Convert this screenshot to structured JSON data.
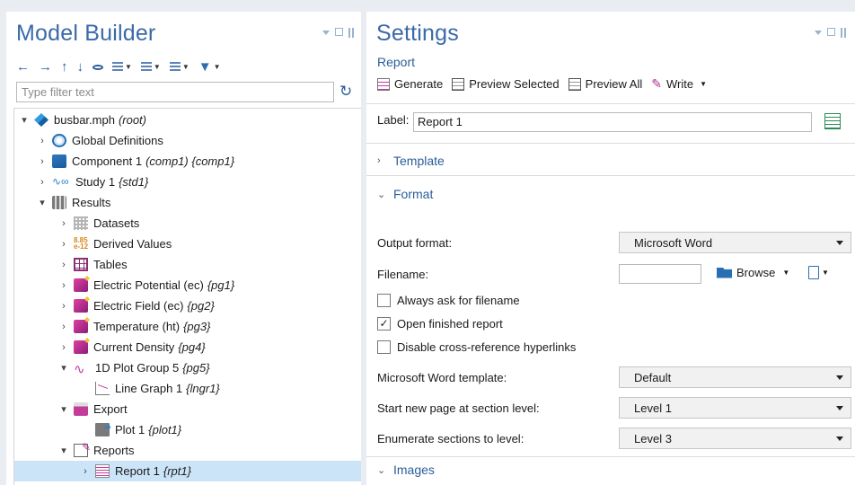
{
  "model_builder": {
    "title": "Model Builder",
    "filter_placeholder": "Type filter text",
    "tree": [
      {
        "label": "busbar.mph",
        "tag": "(root)",
        "icon": "root-icon"
      },
      {
        "label": "Global Definitions",
        "tag": "",
        "icon": "globe-icon"
      },
      {
        "label": "Component 1",
        "tag": "(comp1) {comp1}",
        "icon": "component-icon"
      },
      {
        "label": "Study 1",
        "tag": "{std1}",
        "icon": "study-icon"
      },
      {
        "label": "Results",
        "tag": "",
        "icon": "results-icon"
      },
      {
        "label": "Datasets",
        "tag": "",
        "icon": "datasets-icon"
      },
      {
        "label": "Derived Values",
        "tag": "",
        "icon": "derived-values-icon"
      },
      {
        "label": "Tables",
        "tag": "",
        "icon": "table-icon"
      },
      {
        "label": "Electric Potential (ec)",
        "tag": "{pg1}",
        "icon": "plot-group-3d-icon"
      },
      {
        "label": "Electric Field (ec)",
        "tag": "{pg2}",
        "icon": "plot-group-3d-icon"
      },
      {
        "label": "Temperature (ht)",
        "tag": "{pg3}",
        "icon": "plot-group-3d-icon"
      },
      {
        "label": "Current Density",
        "tag": "{pg4}",
        "icon": "plot-group-3d-icon"
      },
      {
        "label": "1D Plot Group 5",
        "tag": "{pg5}",
        "icon": "plot-group-1d-icon"
      },
      {
        "label": "Line Graph 1",
        "tag": "{lngr1}",
        "icon": "line-graph-icon"
      },
      {
        "label": "Export",
        "tag": "",
        "icon": "export-icon"
      },
      {
        "label": "Plot 1",
        "tag": "{plot1}",
        "icon": "plot-export-icon"
      },
      {
        "label": "Reports",
        "tag": "",
        "icon": "reports-icon"
      },
      {
        "label": "Report 1",
        "tag": "{rpt1}",
        "icon": "report-icon"
      }
    ]
  },
  "settings": {
    "title": "Settings",
    "subtitle": "Report",
    "toolbar": {
      "generate": "Generate",
      "preview_selected": "Preview Selected",
      "preview_all": "Preview All",
      "write": "Write"
    },
    "label_caption": "Label:",
    "label_value": "Report 1",
    "sections": {
      "template": "Template",
      "format": "Format",
      "images": "Images"
    },
    "format": {
      "output_format_label": "Output format:",
      "output_format_value": "Microsoft Word",
      "filename_label": "Filename:",
      "filename_value": "",
      "browse": "Browse",
      "checks": [
        {
          "label": "Always ask for filename",
          "checked": false
        },
        {
          "label": "Open finished report",
          "checked": true
        },
        {
          "label": "Disable cross-reference hyperlinks",
          "checked": false
        }
      ],
      "word_template_label": "Microsoft Word template:",
      "word_template_value": "Default",
      "new_page_label": "Start new page at section level:",
      "new_page_value": "Level 1",
      "enumerate_label": "Enumerate sections to level:",
      "enumerate_value": "Level 3"
    }
  }
}
